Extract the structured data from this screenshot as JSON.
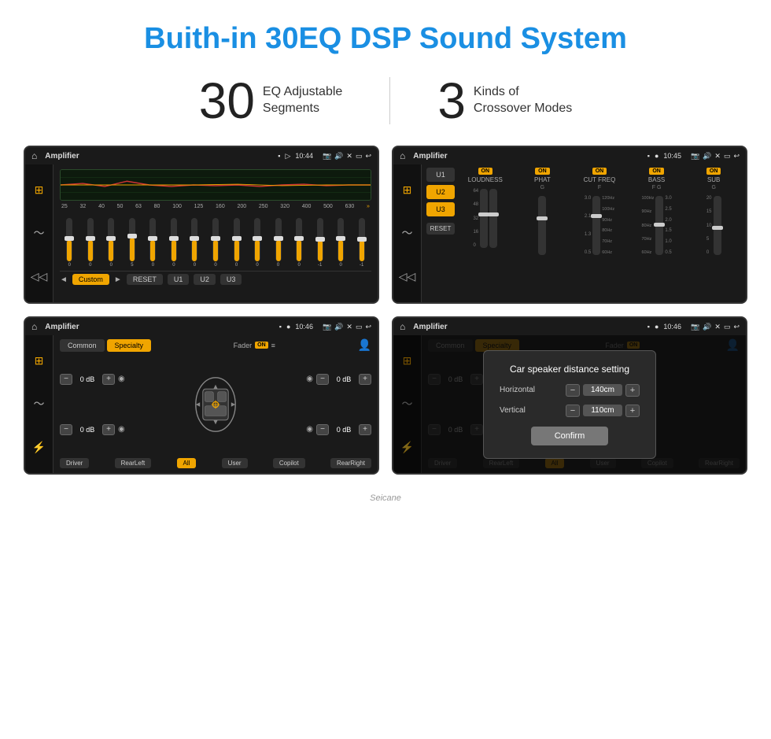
{
  "page": {
    "title": "Buith-in 30EQ DSP Sound System"
  },
  "stats": [
    {
      "number": "30",
      "text": "EQ Adjustable\nSegments"
    },
    {
      "number": "3",
      "text": "Kinds of\nCrossover Modes"
    }
  ],
  "screen1": {
    "status": {
      "title": "Amplifier",
      "time": "10:44"
    },
    "eq_freqs": [
      "25",
      "32",
      "40",
      "50",
      "63",
      "80",
      "100",
      "125",
      "160",
      "200",
      "250",
      "320",
      "400",
      "500",
      "630"
    ],
    "eq_values": [
      "0",
      "0",
      "0",
      "5",
      "0",
      "0",
      "0",
      "0",
      "0",
      "0",
      "0",
      "0",
      "-1",
      "0",
      "-1"
    ],
    "bottom_buttons": [
      "Custom",
      "RESET",
      "U1",
      "U2",
      "U3"
    ]
  },
  "screen2": {
    "status": {
      "title": "Amplifier",
      "time": "10:45"
    },
    "presets": [
      "U1",
      "U2",
      "U3"
    ],
    "channels": [
      {
        "name": "LOUDNESS",
        "on": true
      },
      {
        "name": "PHAT",
        "on": true
      },
      {
        "name": "CUT FREQ",
        "on": true
      },
      {
        "name": "BASS",
        "on": true
      },
      {
        "name": "SUB",
        "on": true
      }
    ]
  },
  "screen3": {
    "status": {
      "title": "Amplifier",
      "time": "10:46"
    },
    "tabs": [
      "Common",
      "Specialty"
    ],
    "active_tab": "Specialty",
    "fader_label": "Fader",
    "fader_on": true,
    "speakers": [
      {
        "label": "0 dB"
      },
      {
        "label": "0 dB"
      },
      {
        "label": "0 dB"
      },
      {
        "label": "0 dB"
      }
    ],
    "bottom_buttons": [
      "Driver",
      "RearLeft",
      "All",
      "User",
      "Copilot",
      "RearRight"
    ]
  },
  "screen4": {
    "status": {
      "title": "Amplifier",
      "time": "10:46"
    },
    "tabs": [
      "Common",
      "Specialty"
    ],
    "active_tab": "Specialty",
    "dialog": {
      "title": "Car speaker distance setting",
      "fields": [
        {
          "label": "Horizontal",
          "value": "140cm"
        },
        {
          "label": "Vertical",
          "value": "110cm"
        }
      ],
      "confirm_label": "Confirm"
    },
    "bottom_buttons": [
      "Driver",
      "RearLeft",
      "All",
      "User",
      "Copilot",
      "RearRight"
    ]
  },
  "watermark": "Seicane"
}
